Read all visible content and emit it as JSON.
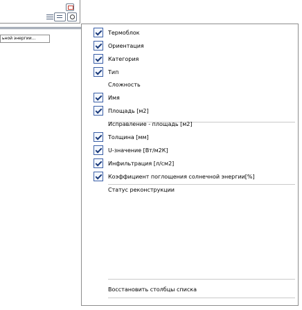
{
  "tabs": {
    "left_tab_label": "ьной энергии..."
  },
  "fields": [
    {
      "label": "Термоблок",
      "checked": true
    },
    {
      "label": "Ориентация",
      "checked": true
    },
    {
      "label": "Категория",
      "checked": true
    },
    {
      "label": "Тип",
      "checked": true
    },
    {
      "label": "Сложность",
      "checked": false
    },
    {
      "label": "Имя",
      "checked": true
    },
    {
      "label": "Площадь [м2]",
      "checked": true
    },
    {
      "label": "Исправление - площадь [м2]",
      "checked": false
    },
    {
      "label": "Толщина [мм]",
      "checked": true
    },
    {
      "label": "U-значение [Вт/м2К]",
      "checked": true
    },
    {
      "label": "Инфильтрация [л/см2]",
      "checked": true
    },
    {
      "label": "Коэффициент поглощения солнечной энергии[%]",
      "checked": true
    },
    {
      "label": "Статус реконструкции",
      "checked": false
    }
  ],
  "footer": {
    "restore_label": "Восстановить столбцы списка"
  },
  "icons": {
    "list": "list-icon",
    "dropdown": "dropdown-icon",
    "search": "search-icon",
    "window": "window-icon"
  }
}
